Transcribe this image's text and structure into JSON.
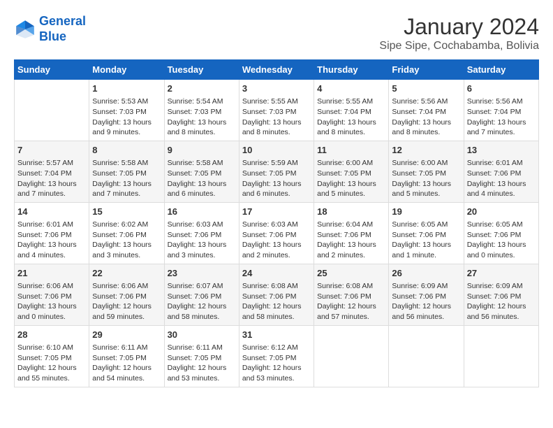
{
  "header": {
    "logo_line1": "General",
    "logo_line2": "Blue",
    "title": "January 2024",
    "subtitle": "Sipe Sipe, Cochabamba, Bolivia"
  },
  "days_of_week": [
    "Sunday",
    "Monday",
    "Tuesday",
    "Wednesday",
    "Thursday",
    "Friday",
    "Saturday"
  ],
  "weeks": [
    [
      {
        "day": "",
        "content": ""
      },
      {
        "day": "1",
        "content": "Sunrise: 5:53 AM\nSunset: 7:03 PM\nDaylight: 13 hours\nand 9 minutes."
      },
      {
        "day": "2",
        "content": "Sunrise: 5:54 AM\nSunset: 7:03 PM\nDaylight: 13 hours\nand 8 minutes."
      },
      {
        "day": "3",
        "content": "Sunrise: 5:55 AM\nSunset: 7:03 PM\nDaylight: 13 hours\nand 8 minutes."
      },
      {
        "day": "4",
        "content": "Sunrise: 5:55 AM\nSunset: 7:04 PM\nDaylight: 13 hours\nand 8 minutes."
      },
      {
        "day": "5",
        "content": "Sunrise: 5:56 AM\nSunset: 7:04 PM\nDaylight: 13 hours\nand 8 minutes."
      },
      {
        "day": "6",
        "content": "Sunrise: 5:56 AM\nSunset: 7:04 PM\nDaylight: 13 hours\nand 7 minutes."
      }
    ],
    [
      {
        "day": "7",
        "content": "Sunrise: 5:57 AM\nSunset: 7:04 PM\nDaylight: 13 hours\nand 7 minutes."
      },
      {
        "day": "8",
        "content": "Sunrise: 5:58 AM\nSunset: 7:05 PM\nDaylight: 13 hours\nand 7 minutes."
      },
      {
        "day": "9",
        "content": "Sunrise: 5:58 AM\nSunset: 7:05 PM\nDaylight: 13 hours\nand 6 minutes."
      },
      {
        "day": "10",
        "content": "Sunrise: 5:59 AM\nSunset: 7:05 PM\nDaylight: 13 hours\nand 6 minutes."
      },
      {
        "day": "11",
        "content": "Sunrise: 6:00 AM\nSunset: 7:05 PM\nDaylight: 13 hours\nand 5 minutes."
      },
      {
        "day": "12",
        "content": "Sunrise: 6:00 AM\nSunset: 7:05 PM\nDaylight: 13 hours\nand 5 minutes."
      },
      {
        "day": "13",
        "content": "Sunrise: 6:01 AM\nSunset: 7:06 PM\nDaylight: 13 hours\nand 4 minutes."
      }
    ],
    [
      {
        "day": "14",
        "content": "Sunrise: 6:01 AM\nSunset: 7:06 PM\nDaylight: 13 hours\nand 4 minutes."
      },
      {
        "day": "15",
        "content": "Sunrise: 6:02 AM\nSunset: 7:06 PM\nDaylight: 13 hours\nand 3 minutes."
      },
      {
        "day": "16",
        "content": "Sunrise: 6:03 AM\nSunset: 7:06 PM\nDaylight: 13 hours\nand 3 minutes."
      },
      {
        "day": "17",
        "content": "Sunrise: 6:03 AM\nSunset: 7:06 PM\nDaylight: 13 hours\nand 2 minutes."
      },
      {
        "day": "18",
        "content": "Sunrise: 6:04 AM\nSunset: 7:06 PM\nDaylight: 13 hours\nand 2 minutes."
      },
      {
        "day": "19",
        "content": "Sunrise: 6:05 AM\nSunset: 7:06 PM\nDaylight: 13 hours\nand 1 minute."
      },
      {
        "day": "20",
        "content": "Sunrise: 6:05 AM\nSunset: 7:06 PM\nDaylight: 13 hours\nand 0 minutes."
      }
    ],
    [
      {
        "day": "21",
        "content": "Sunrise: 6:06 AM\nSunset: 7:06 PM\nDaylight: 13 hours\nand 0 minutes."
      },
      {
        "day": "22",
        "content": "Sunrise: 6:06 AM\nSunset: 7:06 PM\nDaylight: 12 hours\nand 59 minutes."
      },
      {
        "day": "23",
        "content": "Sunrise: 6:07 AM\nSunset: 7:06 PM\nDaylight: 12 hours\nand 58 minutes."
      },
      {
        "day": "24",
        "content": "Sunrise: 6:08 AM\nSunset: 7:06 PM\nDaylight: 12 hours\nand 58 minutes."
      },
      {
        "day": "25",
        "content": "Sunrise: 6:08 AM\nSunset: 7:06 PM\nDaylight: 12 hours\nand 57 minutes."
      },
      {
        "day": "26",
        "content": "Sunrise: 6:09 AM\nSunset: 7:06 PM\nDaylight: 12 hours\nand 56 minutes."
      },
      {
        "day": "27",
        "content": "Sunrise: 6:09 AM\nSunset: 7:06 PM\nDaylight: 12 hours\nand 56 minutes."
      }
    ],
    [
      {
        "day": "28",
        "content": "Sunrise: 6:10 AM\nSunset: 7:05 PM\nDaylight: 12 hours\nand 55 minutes."
      },
      {
        "day": "29",
        "content": "Sunrise: 6:11 AM\nSunset: 7:05 PM\nDaylight: 12 hours\nand 54 minutes."
      },
      {
        "day": "30",
        "content": "Sunrise: 6:11 AM\nSunset: 7:05 PM\nDaylight: 12 hours\nand 53 minutes."
      },
      {
        "day": "31",
        "content": "Sunrise: 6:12 AM\nSunset: 7:05 PM\nDaylight: 12 hours\nand 53 minutes."
      },
      {
        "day": "",
        "content": ""
      },
      {
        "day": "",
        "content": ""
      },
      {
        "day": "",
        "content": ""
      }
    ]
  ]
}
